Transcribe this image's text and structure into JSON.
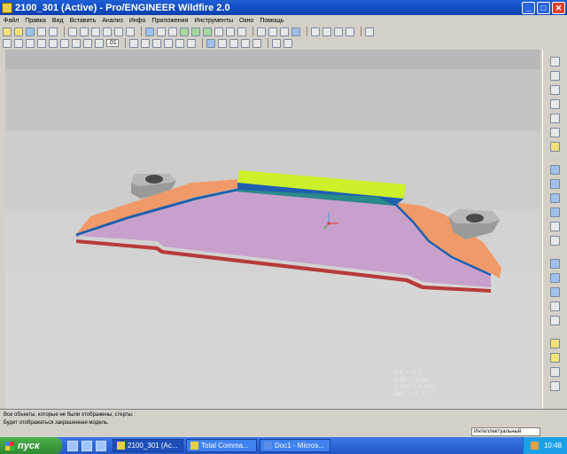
{
  "window": {
    "title": "2100_301 (Active) - Pro/ENGINEER Wildfire 2.0"
  },
  "menu": [
    "Файл",
    "Правка",
    "Вид",
    "Вставить",
    "Анализ",
    "Инфо",
    "Приложения",
    "Инструменты",
    "Окно",
    "Помощь"
  ],
  "toolbar": {
    "value_label": ".01"
  },
  "tolerances": [
    "X.X  +-0.1",
    "X.XX  +-0.01",
    "X.XXX  +-0.001",
    "ANG.  +-0.5"
  ],
  "messages": [
    "Все объекты, которые не были отображены, стерты.",
    "Будет отображаться закрашенная модель."
  ],
  "selection_filter": "Интеллектуальный",
  "taskbar": {
    "start_label": "пуск",
    "tasks": [
      "2100_301 (Ac...",
      "Total Comma...",
      "Doc1 - Micros..."
    ],
    "clock": "10:48"
  },
  "colors": {
    "part_top": "#c8a0cc",
    "flange": "#f09a6a",
    "block_top": "#ccf02a",
    "edge_blue": "#1f5fae"
  }
}
